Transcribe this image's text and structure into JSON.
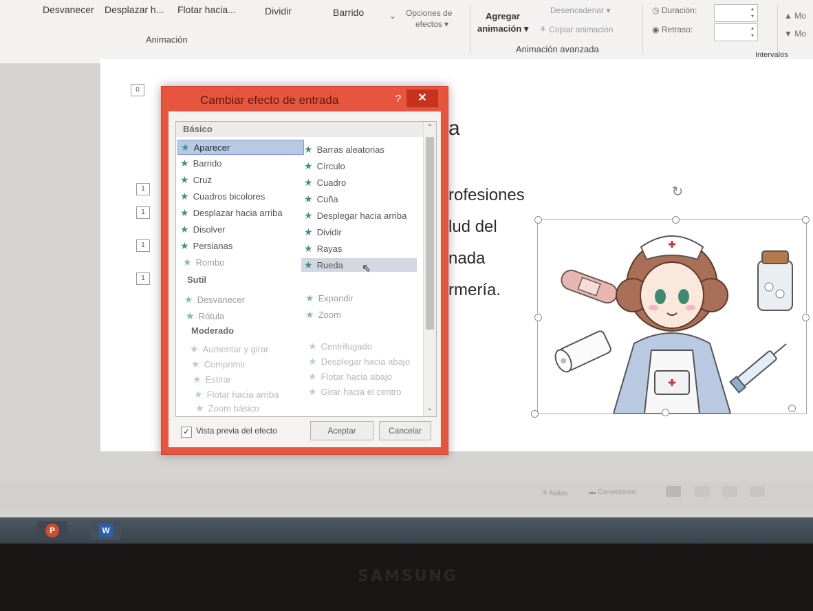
{
  "ribbon": {
    "buttons": [
      "Desvanecer",
      "Desplazar h...",
      "Flotar hacia...",
      "Dividir",
      "Barrido"
    ],
    "effect_options": [
      "Opciones de",
      "efectos ▾"
    ],
    "animation_group": "Animación",
    "add_animation": [
      "Agregar",
      "animación ▾"
    ],
    "trigger": "Desencadenar ▾",
    "copy_animation": "Copiar animación",
    "advanced_group": "Animación avanzada",
    "duration_label": "Duración:",
    "delay_label": "Retraso:",
    "intervals_group": "Intervalos",
    "move_earlier": "▲ Mo",
    "move_later": "▼ Mo"
  },
  "slide": {
    "title_fragment": "a",
    "lines": [
      "rofesiones",
      "lud del",
      "nada",
      "rmería."
    ],
    "animation_tags": [
      "0",
      "1",
      "1",
      "1",
      "1"
    ]
  },
  "dialog": {
    "title": "Cambiar efecto de entrada",
    "help": "?",
    "close": "✕",
    "categories": [
      "Básico",
      "Sutil",
      "Moderado"
    ],
    "basic_left": [
      "Aparecer",
      "Barrido",
      "Cruz",
      "Cuadros bicolores",
      "Desplazar hacia arriba",
      "Disolver",
      "Persianas",
      "Rombo"
    ],
    "basic_right": [
      "Barras aleatorias",
      "Círculo",
      "Cuadro",
      "Cuña",
      "Desplegar hacia arriba",
      "Dividir",
      "Rayas",
      "Rueda"
    ],
    "subtle_left": [
      "Desvanecer",
      "Rótula"
    ],
    "subtle_right": [
      "Expandir",
      "Zoom"
    ],
    "moderate_left": [
      "Aumentar y girar",
      "Comprimir",
      "Estirar",
      "Flotar hacia arriba",
      "Zoom básico"
    ],
    "moderate_right": [
      "Centrifugado",
      "Desplegar hacia abajo",
      "Flotar hacia abajo",
      "Girar hacia el centro"
    ],
    "selected": "Aparecer",
    "hovered": "Rueda",
    "preview_label": "Vista previa del efecto",
    "preview_checked": true,
    "ok": "Aceptar",
    "cancel": "Cancelar"
  },
  "status": {
    "notes": "Notas",
    "comments": "Comentarios"
  },
  "monitor_brand": "SAMSUNG",
  "colors": {
    "dialog_frame": "#e8553f",
    "close_button": "#c7321c",
    "star": "#3f8f83",
    "selection": "#b7c9e3"
  },
  "icons": [
    "star-icon",
    "close-icon",
    "help-icon",
    "checkbox-icon",
    "scroll-up-icon",
    "scroll-down-icon",
    "rotate-handle-icon",
    "cursor-icon"
  ]
}
